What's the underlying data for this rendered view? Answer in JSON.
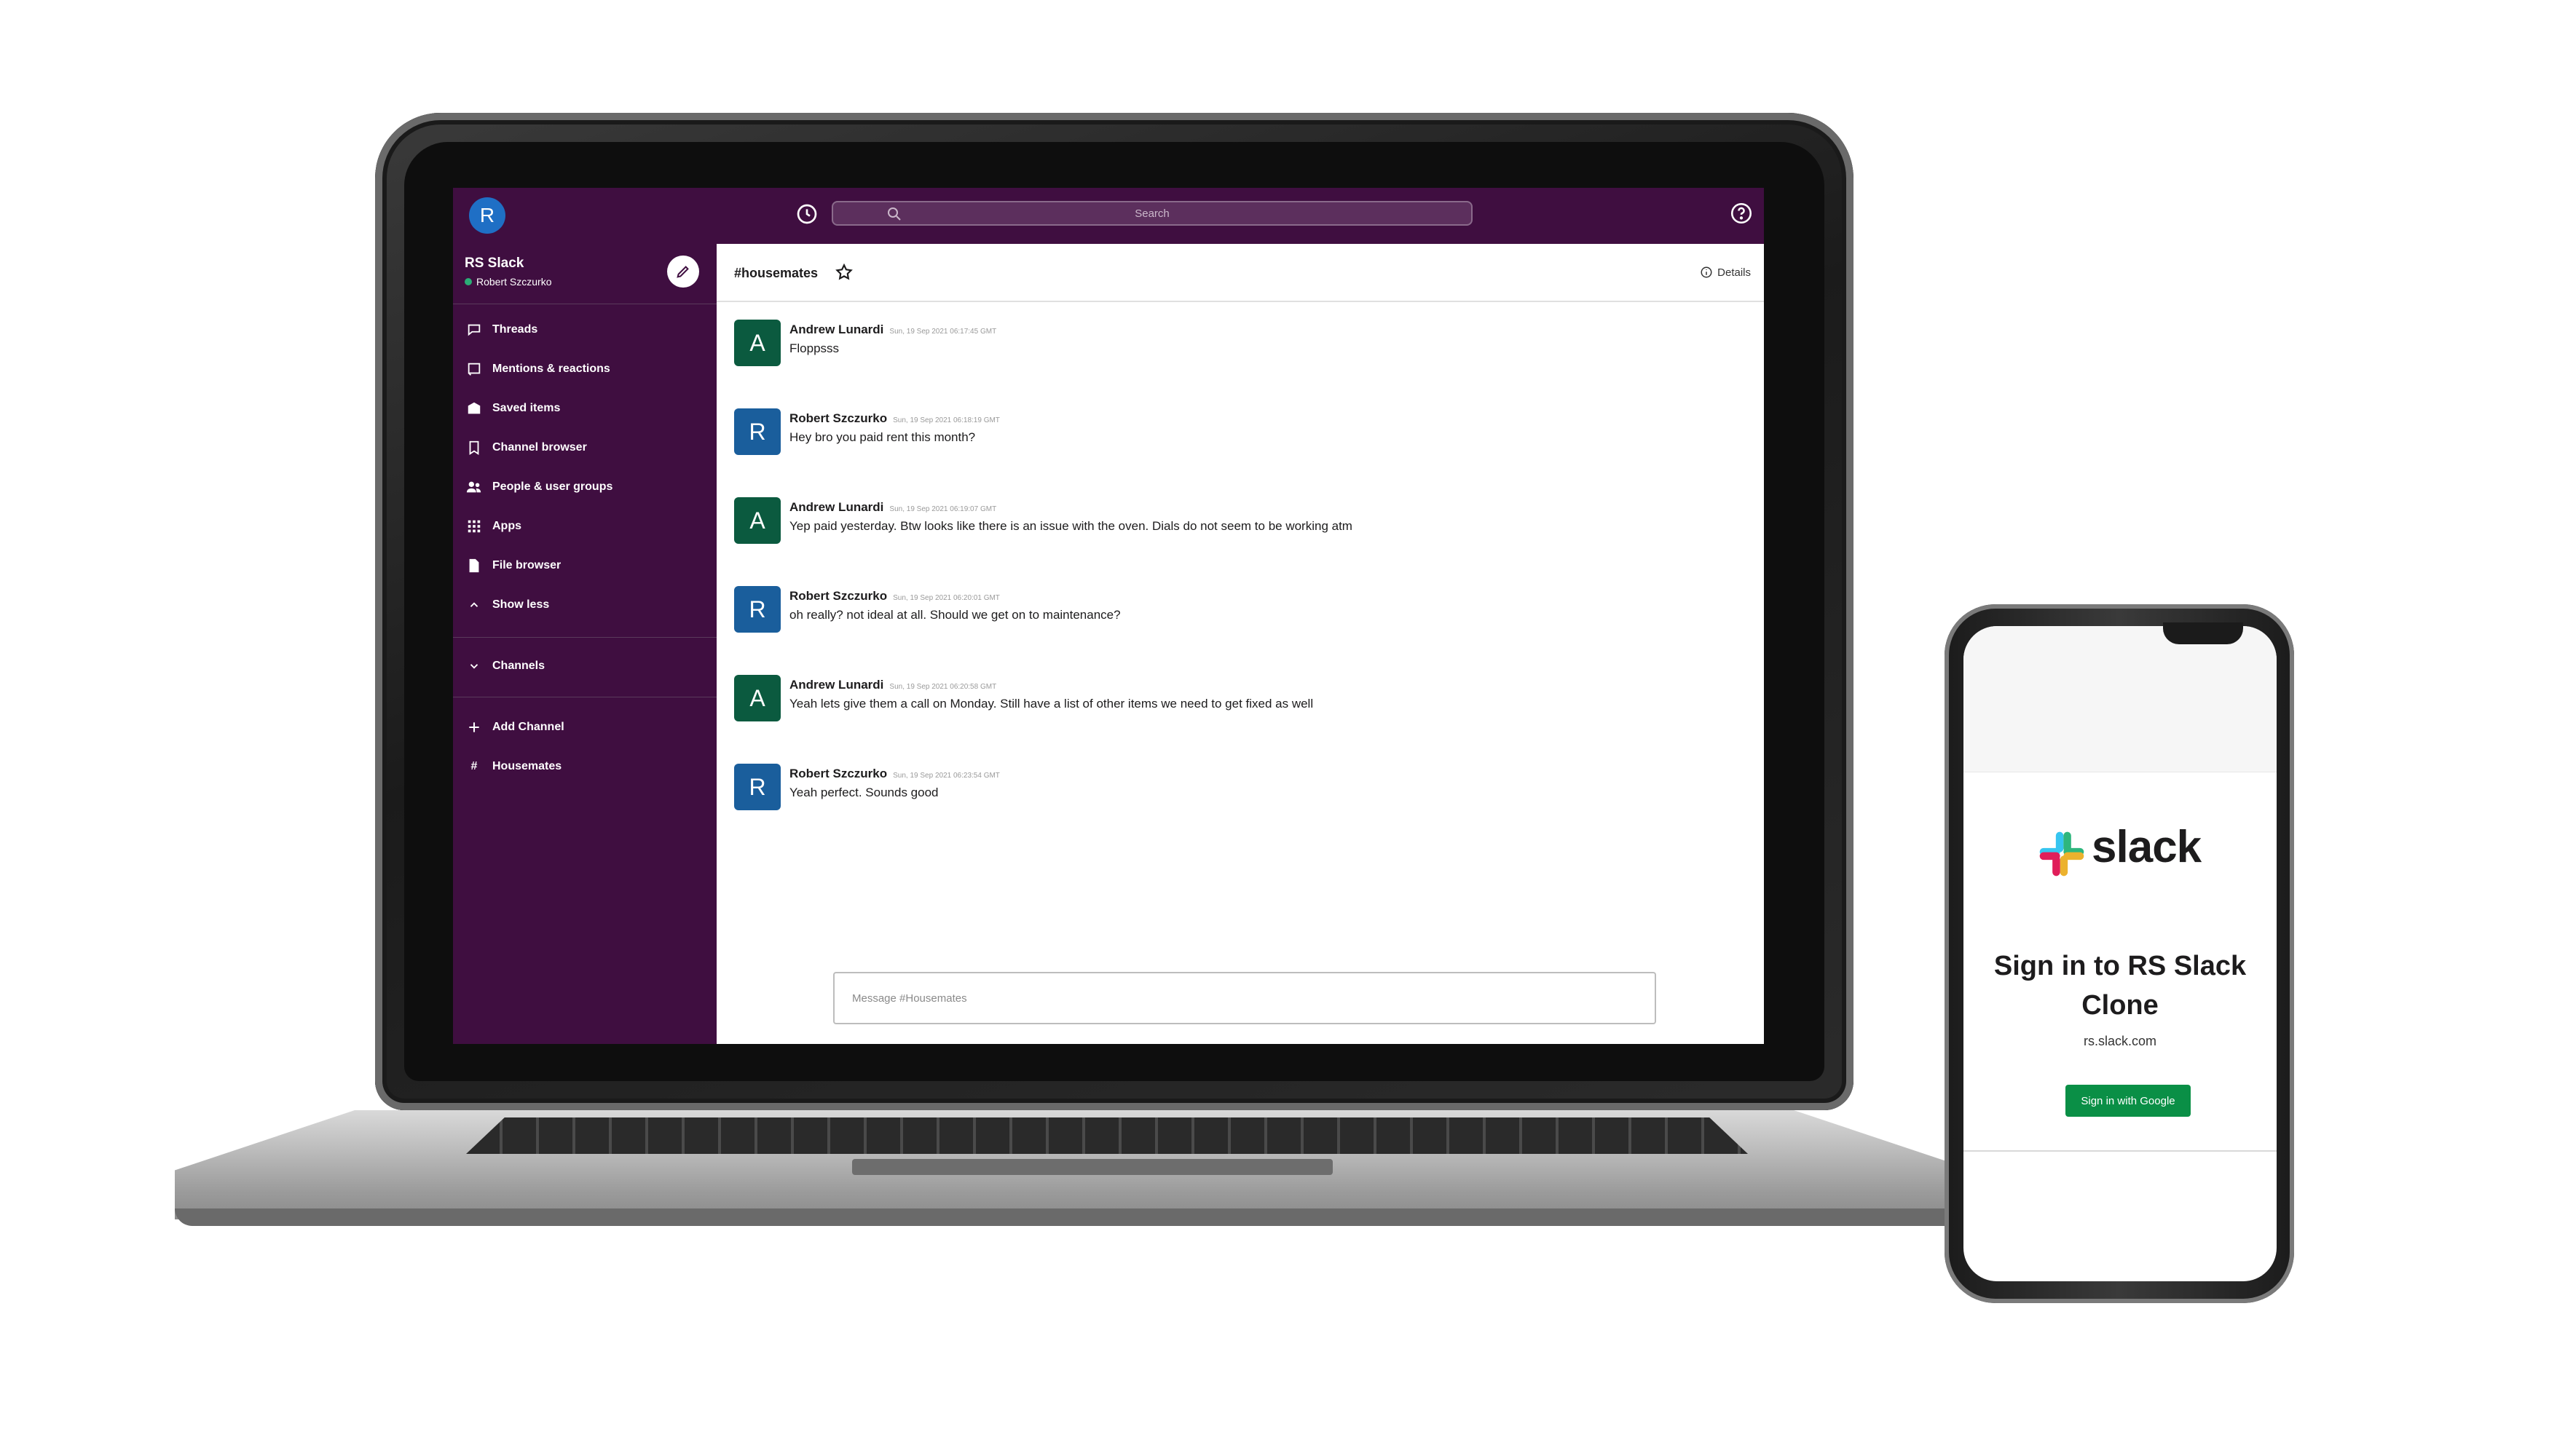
{
  "slack": {
    "topbar": {
      "avatar_letter": "R",
      "search_placeholder": "Search"
    },
    "workspace": {
      "name": "RS Slack",
      "user": "Robert Szczurko"
    },
    "sidebar": {
      "items": [
        {
          "label": "Threads",
          "icon": "threads-icon"
        },
        {
          "label": "Mentions & reactions",
          "icon": "mentions-icon"
        },
        {
          "label": "Saved items",
          "icon": "saved-icon"
        },
        {
          "label": "Channel browser",
          "icon": "bookmark-icon"
        },
        {
          "label": "People & user groups",
          "icon": "people-icon"
        },
        {
          "label": "Apps",
          "icon": "apps-grid-icon"
        },
        {
          "label": "File browser",
          "icon": "file-icon"
        },
        {
          "label": "Show less",
          "icon": "chevron-up-icon"
        }
      ],
      "channels_label": "Channels",
      "add_channel_label": "Add Channel",
      "channel": {
        "hash": "#",
        "name": "Housemates"
      }
    },
    "channel": {
      "title": "#housemates",
      "details_label": "Details"
    },
    "messages": [
      {
        "avatar": "A",
        "name": "Andrew Lunardi",
        "time": "Sun, 19 Sep 2021 06:17:45 GMT",
        "text": "Floppsss",
        "avatar_color": "#0b5a3f"
      },
      {
        "avatar": "R",
        "name": "Robert Szczurko",
        "time": "Sun, 19 Sep 2021 06:18:19 GMT",
        "text": "Hey bro you paid rent this month?",
        "avatar_color": "#1a5e9c"
      },
      {
        "avatar": "A",
        "name": "Andrew Lunardi",
        "time": "Sun, 19 Sep 2021 06:19:07 GMT",
        "text": "Yep paid yesterday. Btw looks like there is an issue with the oven. Dials do not seem to be working atm",
        "avatar_color": "#0b5a3f"
      },
      {
        "avatar": "R",
        "name": "Robert Szczurko",
        "time": "Sun, 19 Sep 2021 06:20:01 GMT",
        "text": "oh really? not ideal at all. Should we get on to maintenance?",
        "avatar_color": "#1a5e9c"
      },
      {
        "avatar": "A",
        "name": "Andrew Lunardi",
        "time": "Sun, 19 Sep 2021 06:20:58 GMT",
        "text": "Yeah lets give them a call on Monday. Still have a list of other items we need to get fixed as well",
        "avatar_color": "#0b5a3f"
      },
      {
        "avatar": "R",
        "name": "Robert Szczurko",
        "time": "Sun, 19 Sep 2021 06:23:54 GMT",
        "text": "Yeah perfect. Sounds good",
        "avatar_color": "#1a5e9c"
      }
    ],
    "composer_placeholder": "Message #Housemates"
  },
  "phone": {
    "logo_text": "slack",
    "title": "Sign in to RS Slack Clone",
    "domain": "rs.slack.com",
    "signin_button": "Sign in with Google"
  },
  "colors": {
    "aubergine": "#3f0e40",
    "online": "#2bac76",
    "google_button": "#0a8f46"
  }
}
